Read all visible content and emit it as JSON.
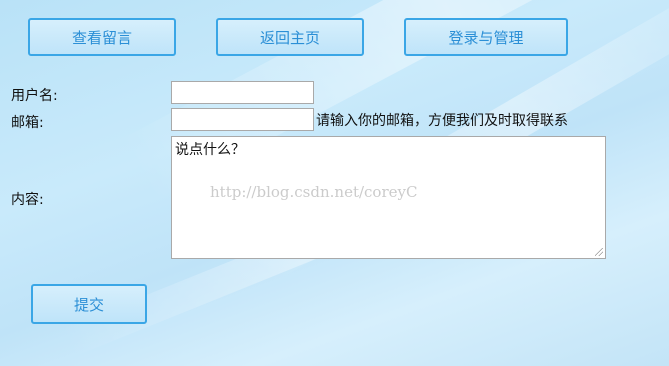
{
  "nav": {
    "view_messages": "查看留言",
    "back_home": "返回主页",
    "login_manage": "登录与管理"
  },
  "form": {
    "username_label": "用户名:",
    "username_value": "",
    "email_label": "邮箱:",
    "email_value": "",
    "email_hint": "请输入你的邮箱，方便我们及时取得联系",
    "content_label": "内容:",
    "content_value": "说点什么？",
    "submit_label": "提交"
  },
  "watermark": "http://blog.csdn.net/coreyC",
  "colors": {
    "button_border": "#3aa6e6",
    "button_text": "#2b8fd6",
    "background": "#c6e8fa"
  }
}
